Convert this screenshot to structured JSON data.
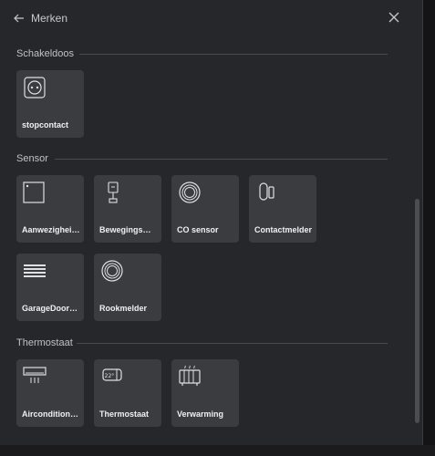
{
  "header": {
    "back_label": "Merken"
  },
  "sections": [
    {
      "title": "Schakeldoos",
      "tiles": [
        {
          "label": "stopcontact",
          "icon": "power-outlet-icon"
        }
      ]
    },
    {
      "title": "Sensor",
      "tiles": [
        {
          "label": "Aanwezigheid…",
          "icon": "presence-sensor-icon"
        },
        {
          "label": "Bewegingsme…",
          "icon": "motion-sensor-icon"
        },
        {
          "label": "CO sensor",
          "icon": "co-sensor-icon"
        },
        {
          "label": "Contactmelder",
          "icon": "contact-sensor-icon"
        },
        {
          "label": "GarageDoorO…",
          "icon": "garage-door-icon"
        },
        {
          "label": "Rookmelder",
          "icon": "smoke-detector-icon"
        }
      ]
    },
    {
      "title": "Thermostaat",
      "tiles": [
        {
          "label": "Airconditioning",
          "icon": "air-conditioner-icon"
        },
        {
          "label": "Thermostaat",
          "icon": "thermostat-icon"
        },
        {
          "label": "Verwarming",
          "icon": "radiator-icon"
        }
      ]
    }
  ],
  "thermostat_display": "22°",
  "colors": {
    "background": "#26272a",
    "tile": "#3b3c40",
    "text": "#f0f0f2"
  }
}
